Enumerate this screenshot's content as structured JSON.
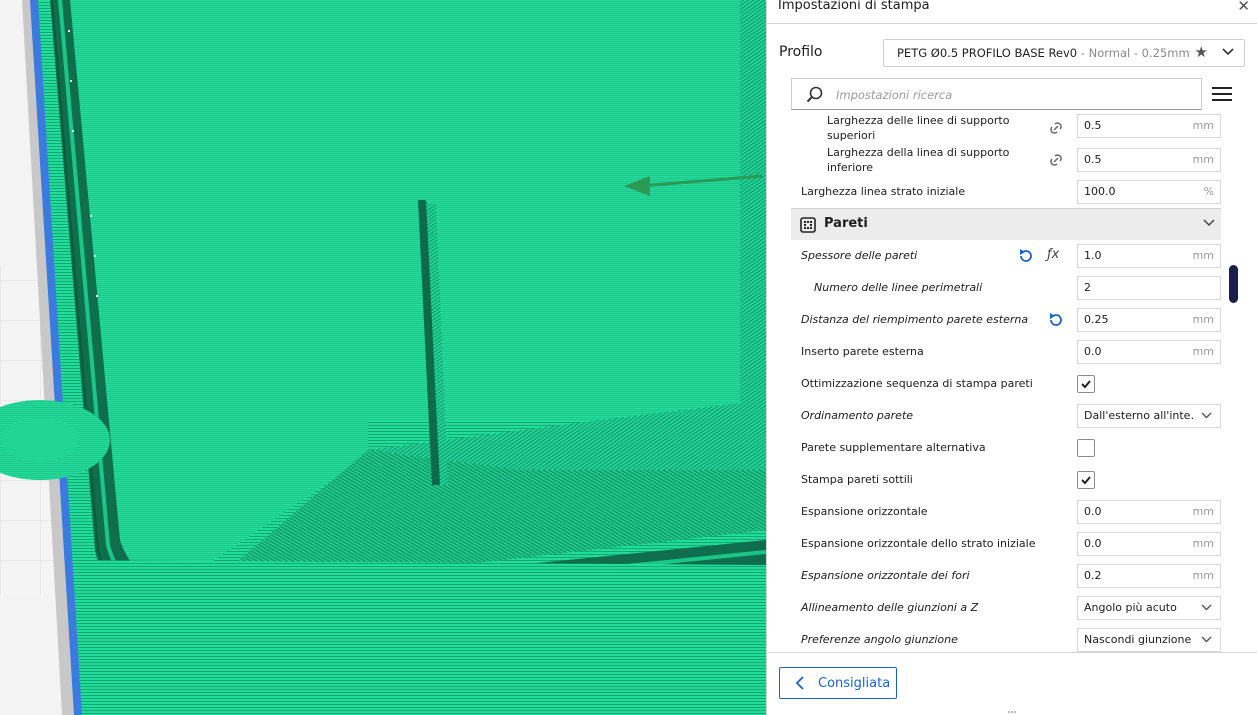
{
  "panel": {
    "title": "Impostazioni di stampa",
    "close_icon": "close-icon",
    "profile_label": "Profilo",
    "profile_name": "PETG Ø0.5 PROFILO BASE Rev0",
    "profile_meta": " - Normal - 0.25mm",
    "search_placeholder": "Impostazioni ricerca",
    "footer_button": "Consigliata"
  },
  "settings": {
    "rows": [
      {
        "label": "Larghezza delle linee di supporto superiori",
        "value": "0.5",
        "unit": "mm",
        "kind": "field",
        "icon": "link-icon"
      },
      {
        "label": "Larghezza della linea di supporto inferiore",
        "value": "0.5",
        "unit": "mm",
        "kind": "field",
        "icon": "link-icon"
      },
      {
        "label": "Larghezza linea strato iniziale",
        "value": "100.0",
        "unit": "%",
        "kind": "field"
      }
    ],
    "category": {
      "label": "Pareti",
      "icon": "walls-icon"
    },
    "walls": [
      {
        "label": "Spessore delle pareti",
        "value": "1.0",
        "unit": "mm",
        "kind": "field",
        "icons": [
          "reset-icon",
          "function-icon"
        ]
      },
      {
        "label": "Numero delle linee perimetrali",
        "value": "2",
        "unit": "",
        "kind": "field"
      },
      {
        "label": "Distanza del riempimento parete esterna",
        "value": "0.25",
        "unit": "mm",
        "kind": "field",
        "icons": [
          "reset-icon"
        ]
      },
      {
        "label": "Inserto parete esterna",
        "value": "0.0",
        "unit": "mm",
        "kind": "field"
      },
      {
        "label": "Ottimizzazione sequenza di stampa pareti",
        "checked": true,
        "kind": "checkbox"
      },
      {
        "label": "Ordinamento parete",
        "value": "Dall'esterno all'inte…",
        "kind": "dropdown"
      },
      {
        "label": "Parete supplementare alternativa",
        "checked": false,
        "kind": "checkbox"
      },
      {
        "label": "Stampa pareti sottili",
        "checked": true,
        "kind": "checkbox"
      },
      {
        "label": "Espansione orizzontale",
        "value": "0.0",
        "unit": "mm",
        "kind": "field"
      },
      {
        "label": "Espansione orizzontale dello strato iniziale",
        "value": "0.0",
        "unit": "mm",
        "kind": "field"
      },
      {
        "label": "Espansione orizzontale dei fori",
        "value": "0.2",
        "unit": "mm",
        "kind": "field"
      },
      {
        "label": "Allineamento delle giunzioni a Z",
        "value": "Angolo più acuto",
        "kind": "dropdown"
      },
      {
        "label": "Preferenze angolo giunzione",
        "value": "Nascondi giunzione",
        "kind": "dropdown"
      }
    ]
  },
  "colors": {
    "model_green": "#21d99a",
    "model_dark": "#0f6e4e",
    "accent_blue": "#1964c8",
    "scrollbar": "#1b1f4c"
  }
}
